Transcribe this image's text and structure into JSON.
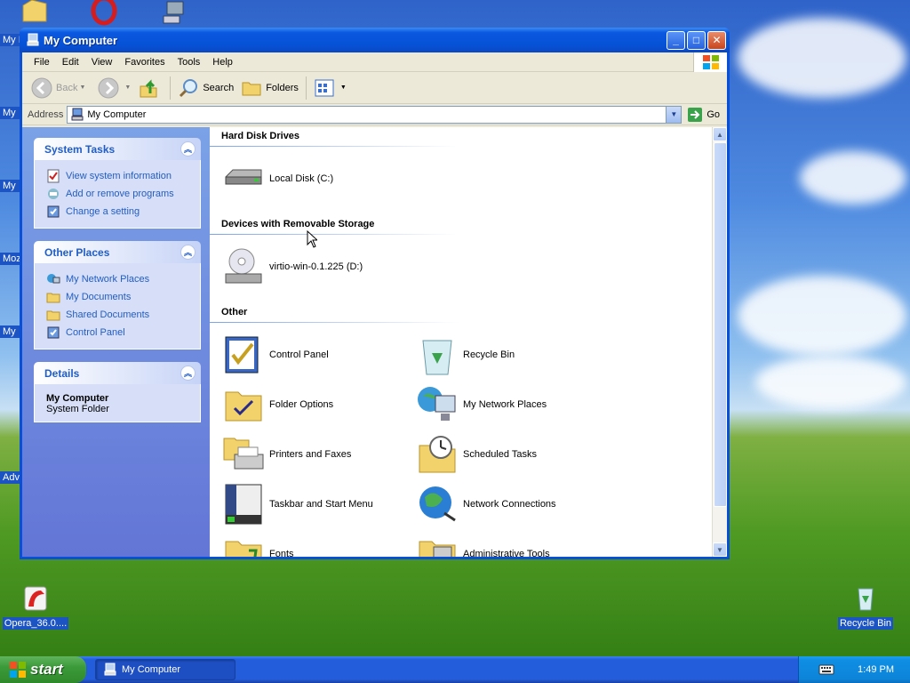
{
  "window": {
    "title": "My Computer",
    "controls": {
      "minimize": "_",
      "maximize": "□",
      "close": "✕"
    }
  },
  "menu": [
    "File",
    "Edit",
    "View",
    "Favorites",
    "Tools",
    "Help"
  ],
  "toolbar": {
    "back": "Back",
    "search": "Search",
    "folders": "Folders"
  },
  "address": {
    "label": "Address",
    "value": "My Computer",
    "go": "Go"
  },
  "taskpane": {
    "system_tasks": {
      "title": "System Tasks",
      "items": [
        "View system information",
        "Add or remove programs",
        "Change a setting"
      ]
    },
    "other_places": {
      "title": "Other Places",
      "items": [
        "My Network Places",
        "My Documents",
        "Shared Documents",
        "Control Panel"
      ]
    },
    "details": {
      "title": "Details",
      "name": "My Computer",
      "type": "System Folder"
    }
  },
  "content": {
    "hard_disks": {
      "title": "Hard Disk Drives",
      "items": [
        "Local Disk (C:)"
      ]
    },
    "removable": {
      "title": "Devices with Removable Storage",
      "items": [
        "virtio-win-0.1.225 (D:)"
      ]
    },
    "other": {
      "title": "Other",
      "items": [
        "Control Panel",
        "Recycle Bin",
        "Folder Options",
        "My Network Places",
        "Printers and Faxes",
        "Scheduled Tasks",
        "Taskbar and Start Menu",
        "Network Connections",
        "Fonts",
        "Administrative Tools"
      ]
    }
  },
  "desktop": {
    "opera_label": "Opera_36.0....",
    "recycle_label": "Recycle Bin",
    "edge_labels": [
      "My I",
      "My",
      "My",
      "Moz",
      "My",
      "Adv"
    ]
  },
  "taskbar": {
    "start": "start",
    "task_button": "My Computer",
    "clock": "1:49 PM"
  },
  "colors": {
    "title_blue": "#0652d6",
    "taskpane_blue": "#7ba2e7",
    "link_blue": "#215dc6",
    "start_green": "#3c9a3a"
  }
}
